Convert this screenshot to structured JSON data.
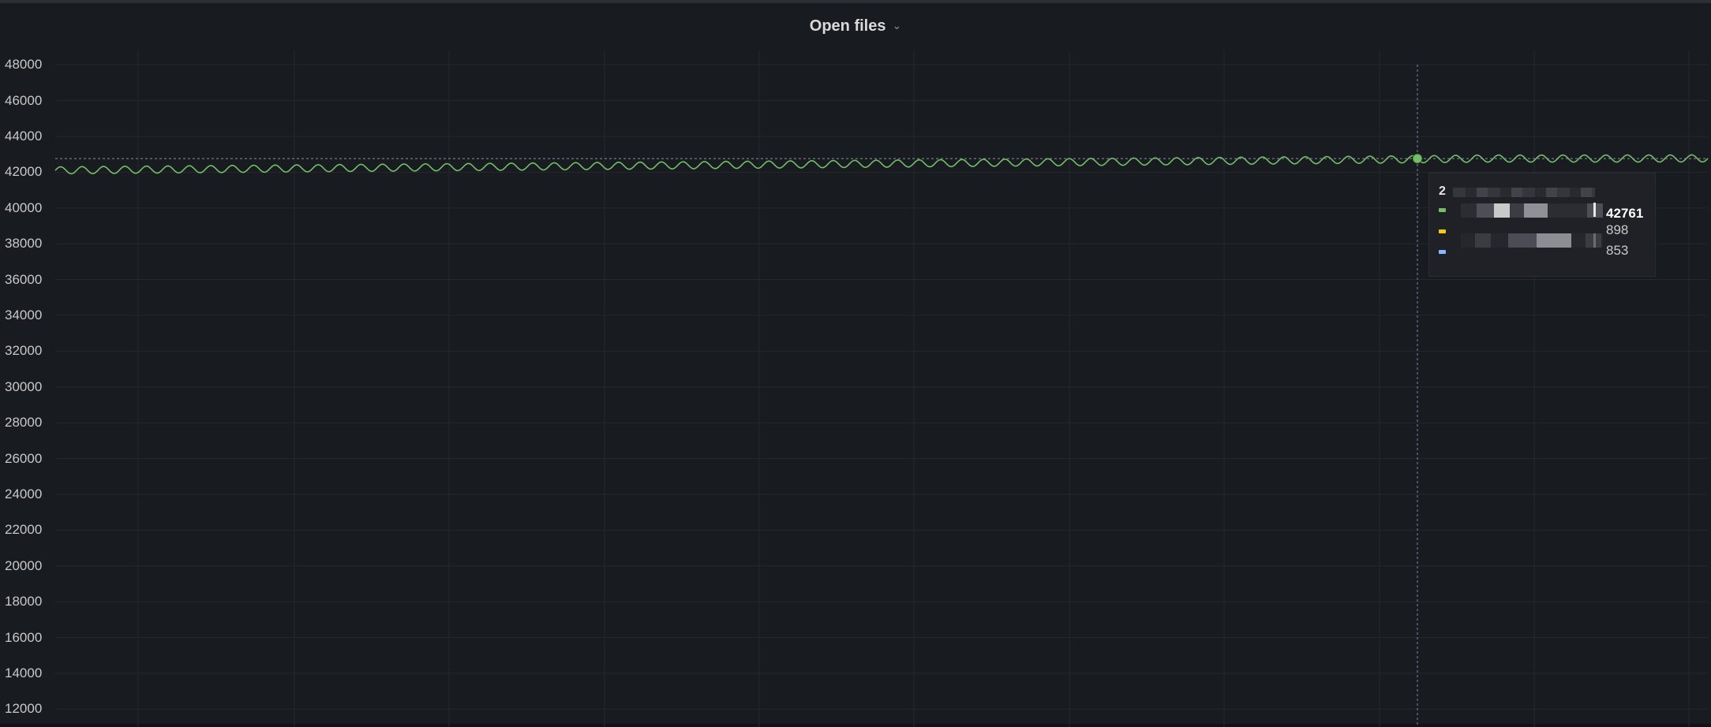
{
  "panel": {
    "title": "Open files",
    "menu_icon": "chevron-down-icon"
  },
  "chart_data": {
    "type": "line",
    "title": "Open files",
    "ylim": [
      11000,
      48800
    ],
    "yticks": [
      48000,
      46000,
      44000,
      42000,
      40000,
      38000,
      36000,
      34000,
      32000,
      30000,
      28000,
      26000,
      24000,
      22000,
      20000,
      18000,
      16000,
      14000,
      12000
    ],
    "grid": true,
    "legend": "none",
    "series": [
      {
        "color": "#73bf69",
        "style": "oscillating line, roughly 77 cycles of about 400 amplitude",
        "values": [
          42100,
          42150,
          42200,
          42250,
          42300,
          42350,
          42400,
          42450,
          42500,
          42550,
          42600,
          42650,
          42700,
          42761,
          42760,
          42770
        ]
      }
    ],
    "crosshair": {
      "value": 42761
    }
  },
  "tooltip": {
    "title_prefix": "2",
    "rows": [
      {
        "color": "#73bf69",
        "value": "42761"
      },
      {
        "color": "#f2cc0c",
        "value": "898"
      },
      {
        "color": "#8ab8ff",
        "value": "853"
      }
    ]
  }
}
